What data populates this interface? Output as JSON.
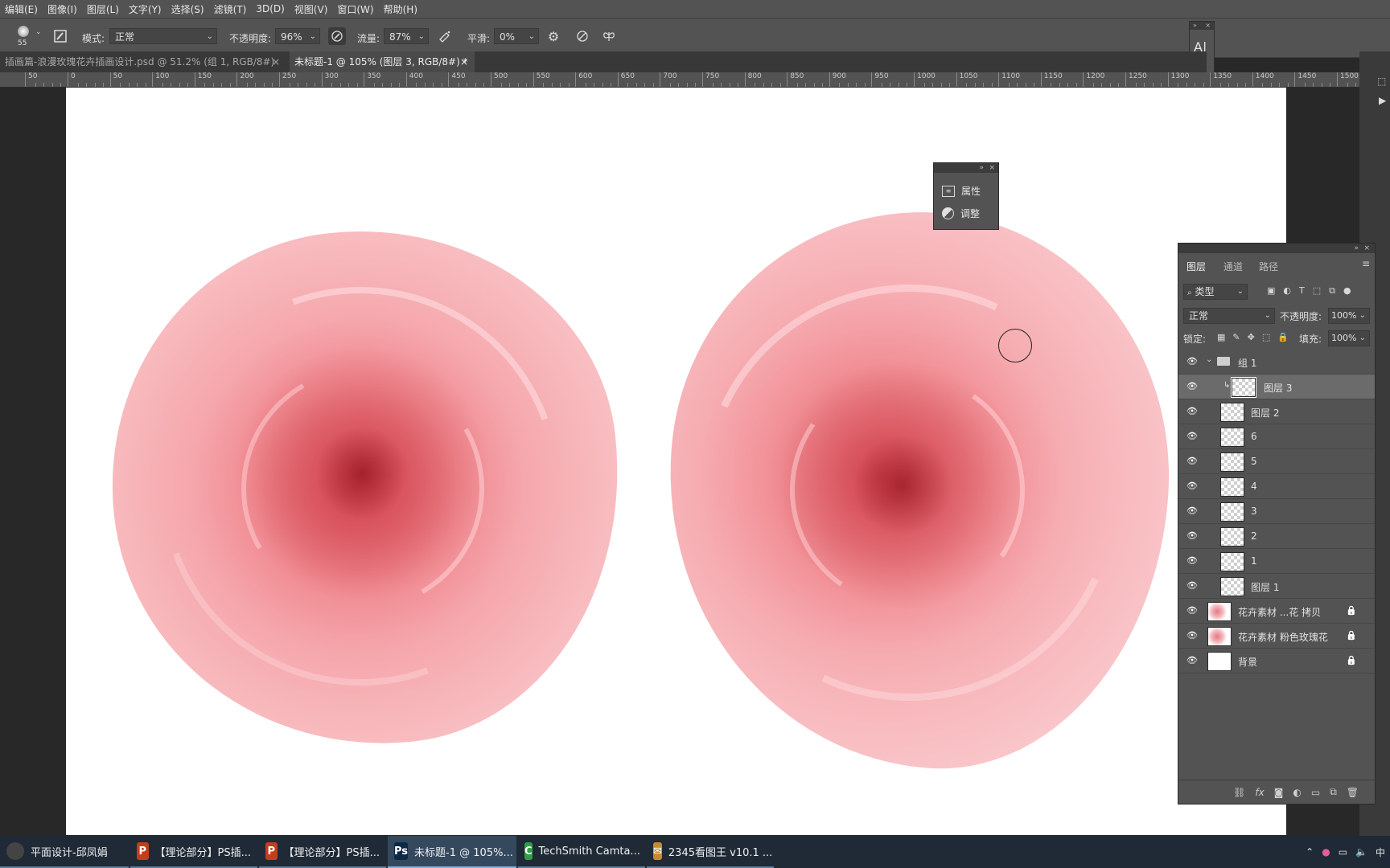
{
  "menu": [
    "编辑(E)",
    "图像(I)",
    "图层(L)",
    "文字(Y)",
    "选择(S)",
    "滤镜(T)",
    "3D(D)",
    "视图(V)",
    "窗口(W)",
    "帮助(H)"
  ],
  "options": {
    "brush_size": "55",
    "mode_label": "模式:",
    "mode_value": "正常",
    "opacity_label": "不透明度:",
    "opacity_value": "96%",
    "flow_label": "流量:",
    "flow_value": "87%",
    "smooth_label": "平滑:",
    "smooth_value": "0%"
  },
  "tabs": [
    {
      "label": "插画篇-浪漫玫瑰花卉插画设计.psd @ 51.2% (组 1, RGB/8#)",
      "close": "×",
      "active": false
    },
    {
      "label": "未标题-1 @ 105% (图层 3, RGB/8#) *",
      "close": "×",
      "active": true
    }
  ],
  "ruler_ticks": [
    "50",
    "0",
    "50",
    "100",
    "150",
    "200",
    "250",
    "300",
    "350",
    "400",
    "450",
    "500",
    "550",
    "600",
    "650",
    "700",
    "750",
    "800",
    "850",
    "900",
    "950",
    "1000",
    "1050",
    "1100",
    "1150",
    "1200",
    "1250",
    "1300",
    "1350",
    "1400",
    "1450",
    "1500"
  ],
  "float_panel": {
    "items": [
      {
        "label": "属性",
        "icon": "properties-icon"
      },
      {
        "label": "调整",
        "icon": "adjustments-icon"
      }
    ]
  },
  "layers_panel": {
    "tabs": [
      "图层",
      "通道",
      "路径"
    ],
    "filter_label": "类型",
    "blend_mode": "正常",
    "opacity_label": "不透明度:",
    "opacity_value": "100%",
    "lock_label": "锁定:",
    "fill_label": "填充:",
    "fill_value": "100%",
    "layers": [
      {
        "name": "组 1",
        "type": "group",
        "selected": false,
        "locked": false
      },
      {
        "name": "图层 3",
        "type": "layer",
        "selected": true,
        "locked": false
      },
      {
        "name": "图层 2",
        "type": "layer",
        "selected": false,
        "locked": false
      },
      {
        "name": "6",
        "type": "layer",
        "selected": false,
        "locked": false
      },
      {
        "name": "5",
        "type": "layer",
        "selected": false,
        "locked": false
      },
      {
        "name": "4",
        "type": "layer",
        "selected": false,
        "locked": false
      },
      {
        "name": "3",
        "type": "layer",
        "selected": false,
        "locked": false
      },
      {
        "name": "2",
        "type": "layer",
        "selected": false,
        "locked": false
      },
      {
        "name": "1",
        "type": "layer",
        "selected": false,
        "locked": false
      },
      {
        "name": "图层 1",
        "type": "layer",
        "selected": false,
        "locked": false
      },
      {
        "name": "花卉素材 ...花 拷贝",
        "type": "image",
        "selected": false,
        "locked": true
      },
      {
        "name": "花卉素材 粉色玫瑰花",
        "type": "image",
        "selected": false,
        "locked": true
      },
      {
        "name": "背景",
        "type": "background",
        "selected": false,
        "locked": true
      }
    ]
  },
  "taskbar": [
    {
      "label": "平面设计-邱凤娟",
      "icon_text": "",
      "color": "#444444",
      "active": false
    },
    {
      "label": "【理论部分】PS插...",
      "icon_text": "P",
      "color": "#c43e1c",
      "active": false
    },
    {
      "label": "【理论部分】PS插...",
      "icon_text": "P",
      "color": "#c43e1c",
      "active": false
    },
    {
      "label": "未标题-1 @ 105%...",
      "icon_text": "Ps",
      "color": "#0d2a44",
      "active": true
    },
    {
      "label": "TechSmith Camta...",
      "icon_text": "C",
      "color": "#2ea043",
      "active": false
    },
    {
      "label": "2345看图王 v10.1 ...",
      "icon_text": "✉",
      "color": "#c98a2b",
      "active": false
    }
  ],
  "tray_ime": "中"
}
